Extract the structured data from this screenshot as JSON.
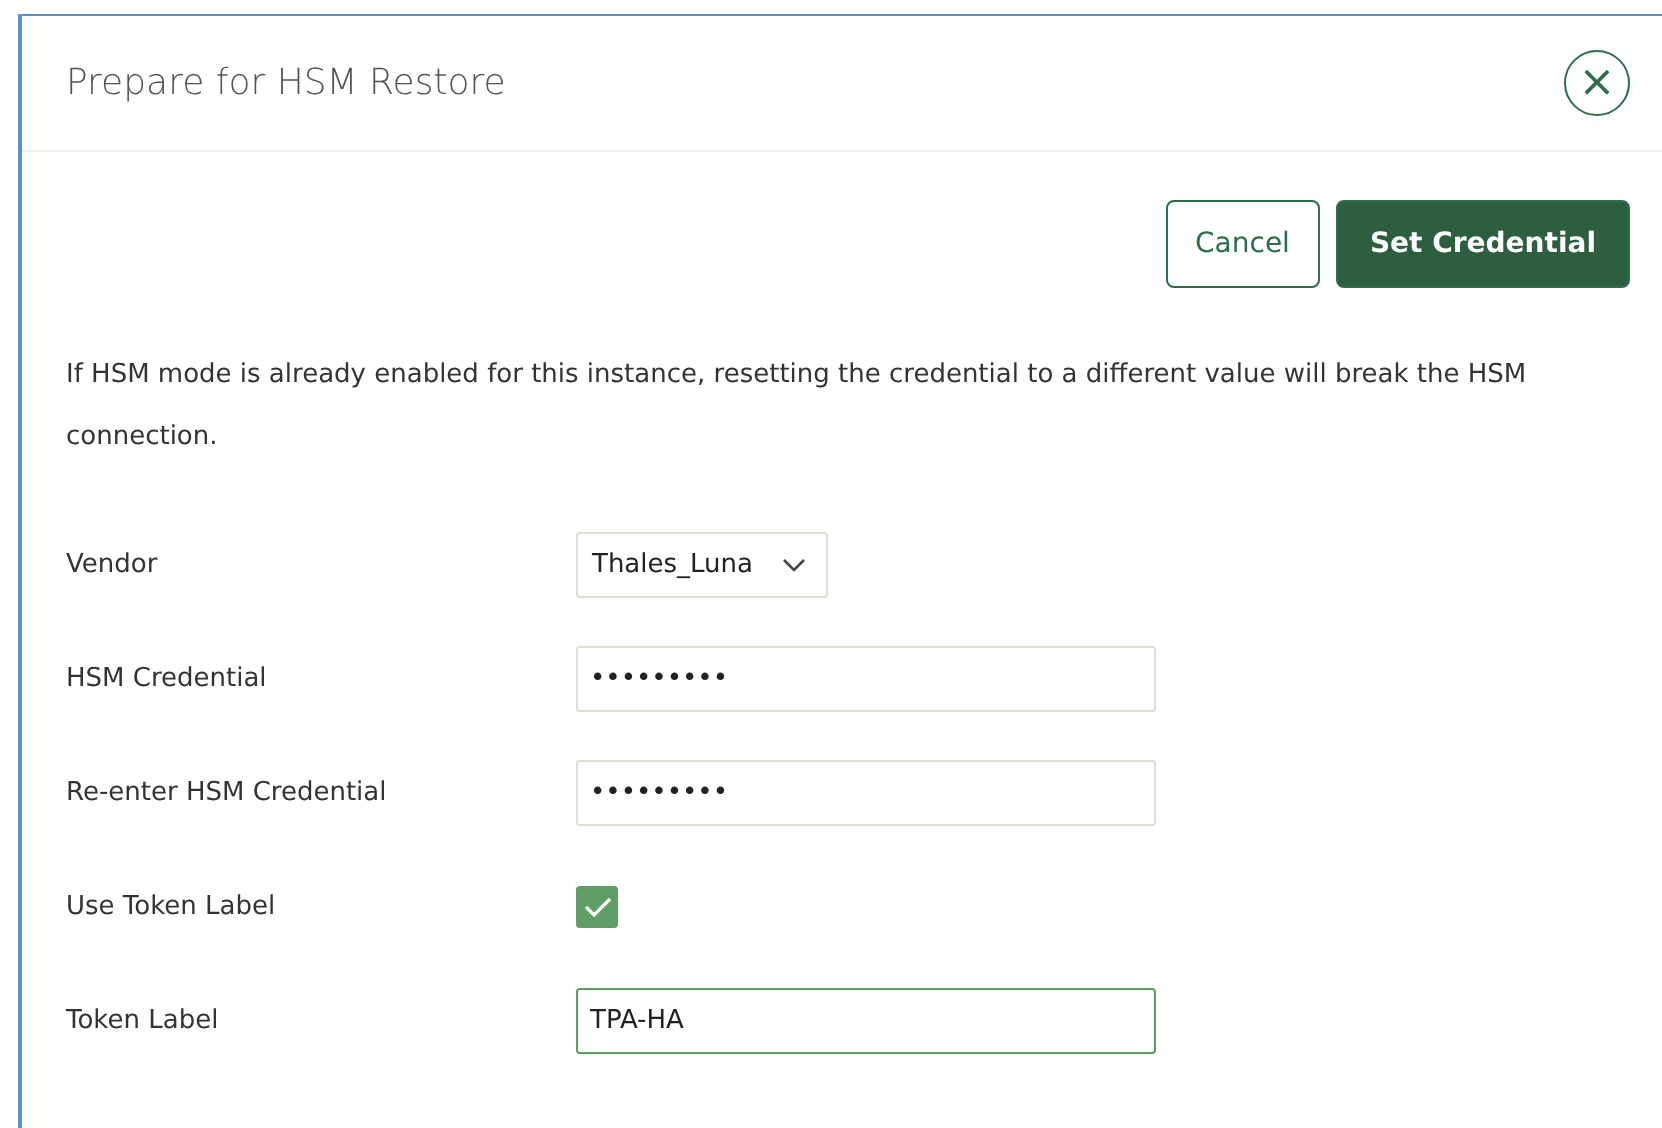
{
  "dialog": {
    "title": "Prepare for HSM Restore",
    "close": "×"
  },
  "buttons": [
    {
      "label": "Cancel",
      "kind": "secondary"
    },
    {
      "label": "Set Credential",
      "kind": "primary"
    }
  ],
  "message": "If HSM mode is already enabled for this instance, resetting the credential to a different value will break the HSM connection.",
  "fields": [
    {
      "label": "Vendor",
      "kind": "select",
      "value": "Thales_Luna"
    },
    {
      "label": "HSM Credential",
      "kind": "password",
      "value": "•••••••••",
      "focused": false
    },
    {
      "label": "Re-enter HSM Credential",
      "kind": "password",
      "value": "•••••••••",
      "focused": false
    },
    {
      "label": "Use Token Label",
      "kind": "checkbox",
      "checked": true
    },
    {
      "label": "Token Label",
      "kind": "text",
      "value": "TPA-HA",
      "focused": true
    }
  ]
}
